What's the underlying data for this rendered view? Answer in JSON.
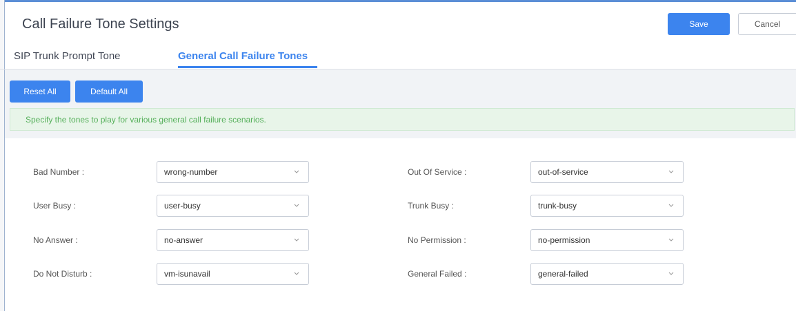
{
  "header": {
    "title": "Call Failure Tone Settings",
    "save_label": "Save",
    "cancel_label": "Cancel"
  },
  "tabs": [
    {
      "label": "SIP Trunk Prompt Tone",
      "active": false
    },
    {
      "label": "General Call Failure Tones",
      "active": true
    }
  ],
  "toolbar": {
    "reset_all_label": "Reset All",
    "default_all_label": "Default All"
  },
  "notice": "Specify the tones to play for various general call failure scenarios.",
  "fields_left": [
    {
      "label": "Bad Number :",
      "value": "wrong-number"
    },
    {
      "label": "User Busy :",
      "value": "user-busy"
    },
    {
      "label": "No Answer :",
      "value": "no-answer"
    },
    {
      "label": "Do Not Disturb :",
      "value": "vm-isunavail"
    }
  ],
  "fields_right": [
    {
      "label": "Out Of Service :",
      "value": "out-of-service"
    },
    {
      "label": "Trunk Busy :",
      "value": "trunk-busy"
    },
    {
      "label": "No Permission :",
      "value": "no-permission"
    },
    {
      "label": "General Failed :",
      "value": "general-failed"
    }
  ],
  "colors": {
    "accent": "#3c84ee",
    "notice_text": "#56b05b",
    "notice_bg": "#e8f5e9"
  },
  "icons": {
    "select_arrow": "chevron-down-icon"
  }
}
